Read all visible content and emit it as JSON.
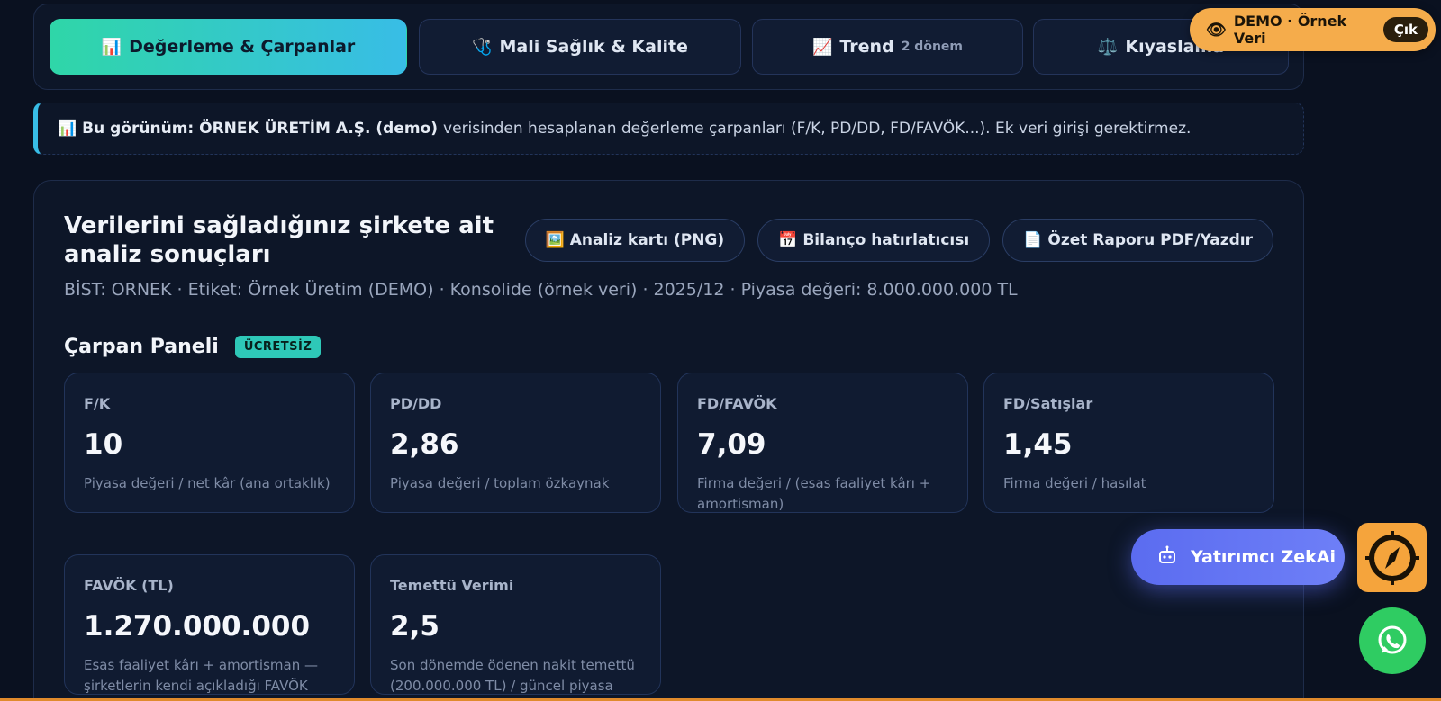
{
  "tabs": [
    {
      "icon": "📊",
      "label": "Değerleme & Çarpanlar",
      "sub": ""
    },
    {
      "icon": "🩺",
      "label": "Mali Sağlık & Kalite",
      "sub": ""
    },
    {
      "icon": "📈",
      "label": "Trend",
      "sub": "2 dönem"
    },
    {
      "icon": "⚖️",
      "label": "Kıyaslama",
      "sub": ""
    }
  ],
  "demo": {
    "label": "DEMO · Örnek Veri",
    "exit": "Çık"
  },
  "info": {
    "icon": "📊",
    "bold": "Bu görünüm: ÖRNEK ÜRETİM A.Ş. (demo)",
    "text": "verisinden hesaplanan değerleme çarpanları (F/K, PD/DD, FD/FAVÖK...). Ek veri girişi gerektirmez."
  },
  "panel": {
    "title": "Verilerini sağladığınız şirkete ait analiz sonuçları",
    "meta": "BİST: ORNEK · Etiket: Örnek Üretim (DEMO) · Konsolide (örnek veri) · 2025/12 · Piyasa değeri: 8.000.000.000 TL",
    "actions": [
      {
        "icon": "🖼️",
        "label": "Analiz kartı (PNG)"
      },
      {
        "icon": "📅",
        "label": "Bilanço hatırlatıcısı"
      },
      {
        "icon": "📄",
        "label": "Özet Raporu PDF/Yazdır"
      }
    ]
  },
  "section": {
    "title": "Çarpan Paneli",
    "badge": "ÜCRETSİZ"
  },
  "cards": [
    {
      "label": "F/K",
      "value": "10",
      "desc": "Piyasa değeri / net kâr (ana ortaklık)"
    },
    {
      "label": "PD/DD",
      "value": "2,86",
      "desc": "Piyasa değeri / toplam özkaynak"
    },
    {
      "label": "FD/FAVÖK",
      "value": "7,09",
      "desc": "Firma değeri / (esas faaliyet kârı + amortisman)"
    },
    {
      "label": "FD/Satışlar",
      "value": "1,45",
      "desc": "Firma değeri / hasılat"
    },
    {
      "label": "FAVÖK (TL)",
      "value": "1.270.000.000",
      "desc": "Esas faaliyet kârı + amortisman — şirketlerin kendi açıkladığı FAVÖK"
    },
    {
      "label": "Temettü Verimi",
      "value": "2,5",
      "desc": "Son dönemde ödenen nakit temettü (200.000.000 TL) / güncel piyasa"
    }
  ],
  "float": {
    "zekai": "Yatırımcı ZekAi"
  },
  "colors": {
    "accent_start": "#2fd6a8",
    "accent_end": "#38bde6",
    "demo": "#f5ac4b",
    "zekai": "#5b6cf0",
    "whatsapp": "#2fcc62"
  }
}
